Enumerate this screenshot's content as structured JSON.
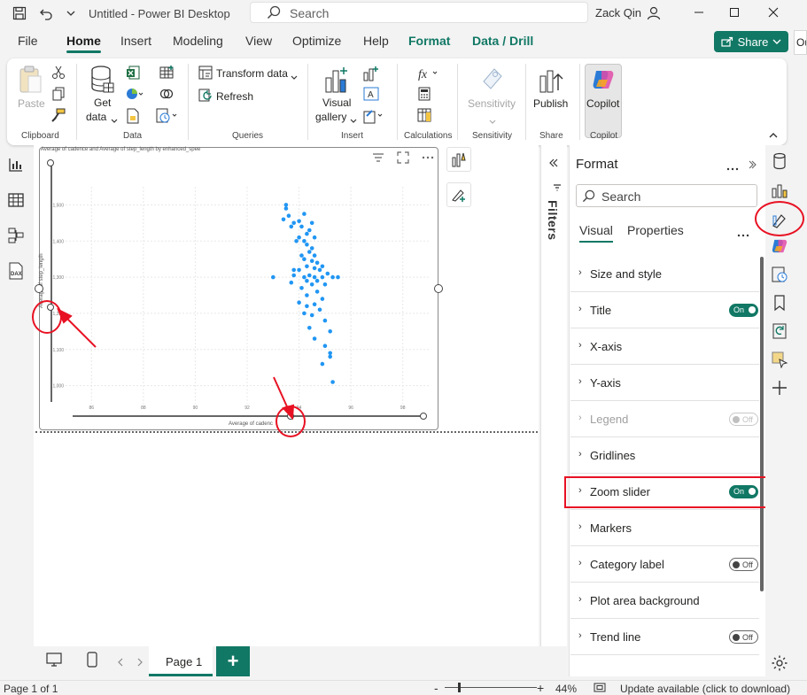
{
  "titlebar": {
    "app_title": "Untitled - Power BI Desktop",
    "search_placeholder": "Search",
    "user_name": "Zack Qin"
  },
  "menu": {
    "tabs": [
      "File",
      "Home",
      "Insert",
      "Modeling",
      "View",
      "Optimize",
      "Help",
      "Format",
      "Data / Drill"
    ],
    "active_tab": "Home",
    "share_label": "Share",
    "right_cut_text": "Ou"
  },
  "ribbon": {
    "paste": "Paste",
    "get_data_1": "Get",
    "get_data_2": "data",
    "transform_data": "Transform data",
    "refresh": "Refresh",
    "visual_gallery_1": "Visual",
    "visual_gallery_2": "gallery",
    "sensitivity": "Sensitivity",
    "publish": "Publish",
    "copilot": "Copilot",
    "groups": {
      "clipboard": "Clipboard",
      "data": "Data",
      "queries": "Queries",
      "insert": "Insert",
      "calculations": "Calculations",
      "sensitivity": "Sensitivity",
      "share": "Share",
      "copilot": "Copilot"
    }
  },
  "visual": {
    "title": "Average of cadence and Average of step_length by enhanced_spee",
    "xlabel": "Average of cadenc",
    "ylabel": "Average of step_length"
  },
  "chart_data": {
    "type": "scatter",
    "title": "Average of cadence and Average of step_length by enhanced_spee",
    "xlabel": "Average of cadence",
    "ylabel": "Average of step_length",
    "x_ticks": [
      "86",
      "88",
      "90",
      "92",
      "94",
      "96",
      "98"
    ],
    "y_ticks": [
      "1,000",
      "1,100",
      "1,200",
      "1,300",
      "1,400",
      "1,500"
    ],
    "xlim": [
      85,
      99
    ],
    "ylim": [
      950,
      1550
    ],
    "point_color": "#2196f3",
    "points": [
      [
        93.5,
        1500
      ],
      [
        93.5,
        1490
      ],
      [
        93.6,
        1470
      ],
      [
        93.4,
        1460
      ],
      [
        93.8,
        1450
      ],
      [
        94.2,
        1475
      ],
      [
        94.0,
        1455
      ],
      [
        93.7,
        1440
      ],
      [
        94.1,
        1440
      ],
      [
        94.5,
        1450
      ],
      [
        94.4,
        1430
      ],
      [
        94.3,
        1420
      ],
      [
        94.6,
        1410
      ],
      [
        94.0,
        1410
      ],
      [
        94.2,
        1400
      ],
      [
        94.3,
        1390
      ],
      [
        94.5,
        1380
      ],
      [
        94.4,
        1370
      ],
      [
        94.6,
        1360
      ],
      [
        94.2,
        1350
      ],
      [
        94.5,
        1345
      ],
      [
        94.7,
        1340
      ],
      [
        94.3,
        1330
      ],
      [
        94.6,
        1325
      ],
      [
        94.0,
        1320
      ],
      [
        94.8,
        1320
      ],
      [
        95.1,
        1310
      ],
      [
        94.4,
        1305
      ],
      [
        93.8,
        1305
      ],
      [
        95.3,
        1300
      ],
      [
        94.9,
        1300
      ],
      [
        94.6,
        1300
      ],
      [
        94.2,
        1300
      ],
      [
        93.0,
        1300
      ],
      [
        95.5,
        1300
      ],
      [
        94.7,
        1290
      ],
      [
        94.3,
        1290
      ],
      [
        93.7,
        1285
      ],
      [
        95.0,
        1280
      ],
      [
        94.5,
        1280
      ],
      [
        94.1,
        1270
      ],
      [
        94.7,
        1260
      ],
      [
        94.3,
        1250
      ],
      [
        94.9,
        1240
      ],
      [
        94.0,
        1230
      ],
      [
        94.6,
        1225
      ],
      [
        94.3,
        1220
      ],
      [
        94.8,
        1210
      ],
      [
        94.2,
        1200
      ],
      [
        94.5,
        1195
      ],
      [
        95.0,
        1180
      ],
      [
        94.4,
        1160
      ],
      [
        95.2,
        1150
      ],
      [
        94.6,
        1130
      ],
      [
        95.0,
        1110
      ],
      [
        95.2,
        1090
      ],
      [
        95.2,
        1080
      ],
      [
        94.9,
        1060
      ],
      [
        95.3,
        1010
      ],
      [
        93.8,
        1320
      ],
      [
        94.9,
        1330
      ],
      [
        93.9,
        1400
      ],
      [
        94.1,
        1360
      ]
    ]
  },
  "canvas_actions": [
    "build-visual",
    "format-visual"
  ],
  "filters_label": "Filters",
  "format_pane": {
    "title": "Format",
    "search_placeholder": "Search",
    "tab_visual": "Visual",
    "tab_properties": "Properties",
    "sections": [
      {
        "label": "Size and style",
        "toggle": null,
        "disabled": false
      },
      {
        "label": "Title",
        "toggle": "On",
        "disabled": false
      },
      {
        "label": "X-axis",
        "toggle": null,
        "disabled": false
      },
      {
        "label": "Y-axis",
        "toggle": null,
        "disabled": false
      },
      {
        "label": "Legend",
        "toggle": "Off",
        "disabled": true
      },
      {
        "label": "Gridlines",
        "toggle": null,
        "disabled": false
      },
      {
        "label": "Zoom slider",
        "toggle": "On",
        "disabled": false
      },
      {
        "label": "Markers",
        "toggle": null,
        "disabled": false
      },
      {
        "label": "Category label",
        "toggle": "Off",
        "disabled": false
      },
      {
        "label": "Plot area background",
        "toggle": null,
        "disabled": false
      },
      {
        "label": "Trend line",
        "toggle": "Off",
        "disabled": false
      }
    ]
  },
  "pages": {
    "current": "Page 1",
    "add_label": "+"
  },
  "statusbar": {
    "page_info": "Page 1 of 1",
    "zoom_minus": "-",
    "zoom_plus": "+",
    "zoom": "44%",
    "update": "Update available (click to download)"
  },
  "colors": {
    "accent": "#117865",
    "highlight": "#e81123",
    "point": "#2196f3"
  }
}
